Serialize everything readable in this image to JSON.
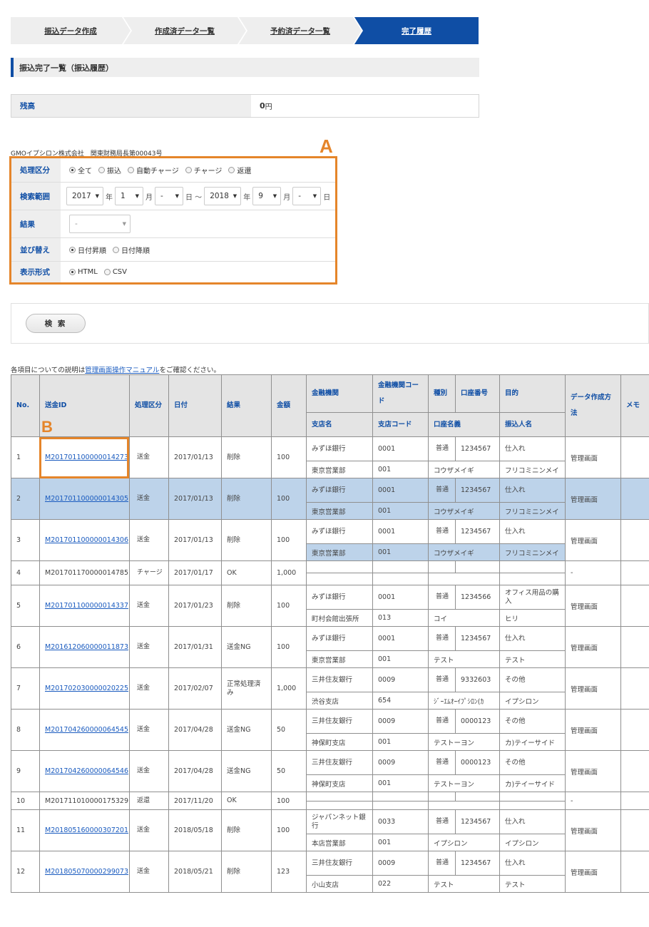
{
  "steps": [
    "振込データ作成",
    "作成済データ一覧",
    "予約済データ一覧",
    "完了履歴"
  ],
  "section_title": "振込完了一覧（振込履歴）",
  "balance": {
    "label": "残高",
    "amount": "0",
    "unit": "円"
  },
  "company": "GMOイプシロン株式会社　関東財務局長第00043号",
  "callouts": {
    "a": "A",
    "b": "B"
  },
  "form": {
    "type_label": "処理区分",
    "type_options": [
      "全て",
      "振込",
      "自動チャージ",
      "チャージ",
      "返還"
    ],
    "range_label": "検索範囲",
    "from_year": "2017",
    "from_month": "1",
    "from_day": "-",
    "to_year": "2018",
    "to_month": "9",
    "to_day": "-",
    "year_unit": "年",
    "month_unit": "月",
    "day_unit": "日",
    "tilde": "日 ～",
    "result_label": "結果",
    "result_value": "-",
    "sort_label": "並び替え",
    "sort_options": [
      "日付昇順",
      "日付降順"
    ],
    "format_label": "表示形式",
    "format_options": [
      "HTML",
      "CSV"
    ]
  },
  "search_button": "検 索",
  "note": {
    "before": "各項目についての説明は",
    "link": "管理画面操作マニュアル",
    "after": "をご確認ください。"
  },
  "headers": {
    "no": "No.",
    "id": "送金ID",
    "kind": "処理区分",
    "date": "日付",
    "result": "結果",
    "amount": "金額",
    "bank": "金融機関",
    "bank_code": "金融機関コード",
    "acc_type": "種別",
    "acc_no": "口座番号",
    "purpose": "目的",
    "branch": "支店名",
    "branch_code": "支店コード",
    "acc_name": "口座名義",
    "payer": "振込人名",
    "method": "データ作成方法",
    "memo": "メモ"
  },
  "rows": [
    {
      "no": "1",
      "id": "M201701100000014273",
      "link": true,
      "kind": "送金",
      "date": "2017/01/13",
      "result": "削除",
      "amount": "100",
      "bank": "みずほ銀行",
      "bank_code": "0001",
      "acc_type": "普通",
      "acc_no": "1234567",
      "purpose": "仕入れ",
      "branch": "東京営業部",
      "branch_code": "001",
      "acc_name": "コウザメイギ",
      "payer": "フリコミニンメイ",
      "method": "管理画面"
    },
    {
      "no": "2",
      "id": "M201701100000014305",
      "link": true,
      "kind": "送金",
      "date": "2017/01/13",
      "result": "削除",
      "amount": "100",
      "bank": "みずほ銀行",
      "bank_code": "0001",
      "acc_type": "普通",
      "acc_no": "1234567",
      "purpose": "仕入れ",
      "branch": "東京営業部",
      "branch_code": "001",
      "acc_name": "コウザメイギ",
      "payer": "フリコミニンメイ",
      "method": "管理画面"
    },
    {
      "no": "3",
      "id": "M201701100000014306",
      "link": true,
      "kind": "送金",
      "date": "2017/01/13",
      "result": "削除",
      "amount": "100",
      "bank": "みずほ銀行",
      "bank_code": "0001",
      "acc_type": "普通",
      "acc_no": "1234567",
      "purpose": "仕入れ",
      "branch": "東京営業部",
      "branch_code": "001",
      "acc_name": "コウザメイギ",
      "payer": "フリコミニンメイ",
      "method": "管理画面"
    },
    {
      "no": "4",
      "id": "M201701170000014785",
      "link": false,
      "kind": "チャージ",
      "date": "2017/01/17",
      "result": "OK",
      "amount": "1,000",
      "bank": "",
      "bank_code": "",
      "acc_type": "",
      "acc_no": "",
      "purpose": "",
      "branch": "",
      "branch_code": "",
      "acc_name": "",
      "payer": "",
      "method": "-"
    },
    {
      "no": "5",
      "id": "M201701100000014337",
      "link": true,
      "kind": "送金",
      "date": "2017/01/23",
      "result": "削除",
      "amount": "100",
      "bank": "みずほ銀行",
      "bank_code": "0001",
      "acc_type": "普通",
      "acc_no": "1234566",
      "purpose": "オフィス用品の購入",
      "branch": "町村会館出張所",
      "branch_code": "013",
      "acc_name": "コイ",
      "payer": "ヒリ",
      "method": "管理画面"
    },
    {
      "no": "6",
      "id": "M201612060000011873",
      "link": true,
      "kind": "送金",
      "date": "2017/01/31",
      "result": "送金NG",
      "amount": "100",
      "bank": "みずほ銀行",
      "bank_code": "0001",
      "acc_type": "普通",
      "acc_no": "1234567",
      "purpose": "仕入れ",
      "branch": "東京営業部",
      "branch_code": "001",
      "acc_name": "テスト",
      "payer": "テスト",
      "method": "管理画面"
    },
    {
      "no": "7",
      "id": "M201702030000020225",
      "link": true,
      "kind": "送金",
      "date": "2017/02/07",
      "result": "正常処理済み",
      "amount": "1,000",
      "bank": "三井住友銀行",
      "bank_code": "0009",
      "acc_type": "普通",
      "acc_no": "9332603",
      "purpose": "その他",
      "branch": "渋谷支店",
      "branch_code": "654",
      "acc_name": "ｼﾞｰｴﾑｵｰｲﾌﾟｼﾛﾝ(ｶ",
      "payer": "イプシロン",
      "method": "管理画面"
    },
    {
      "no": "8",
      "id": "M201704260000064545",
      "link": true,
      "kind": "送金",
      "date": "2017/04/28",
      "result": "送金NG",
      "amount": "50",
      "bank": "三井住友銀行",
      "bank_code": "0009",
      "acc_type": "普通",
      "acc_no": "0000123",
      "purpose": "その他",
      "branch": "神保町支店",
      "branch_code": "001",
      "acc_name": "テストーヨン",
      "payer": "カ)テイーサイド",
      "method": "管理画面"
    },
    {
      "no": "9",
      "id": "M201704260000064546",
      "link": true,
      "kind": "送金",
      "date": "2017/04/28",
      "result": "送金NG",
      "amount": "50",
      "bank": "三井住友銀行",
      "bank_code": "0009",
      "acc_type": "普通",
      "acc_no": "0000123",
      "purpose": "その他",
      "branch": "神保町支店",
      "branch_code": "001",
      "acc_name": "テストーヨン",
      "payer": "カ)テイーサイド",
      "method": "管理画面"
    },
    {
      "no": "10",
      "id": "M201711010000175329",
      "link": false,
      "kind": "返還",
      "date": "2017/11/20",
      "result": "OK",
      "amount": "100",
      "bank": "",
      "bank_code": "",
      "acc_type": "",
      "acc_no": "",
      "purpose": "",
      "branch": "",
      "branch_code": "",
      "acc_name": "",
      "payer": "",
      "method": "-"
    },
    {
      "no": "11",
      "id": "M201805160000307201",
      "link": true,
      "kind": "送金",
      "date": "2018/05/18",
      "result": "削除",
      "amount": "100",
      "bank": "ジャパンネット銀行",
      "bank_code": "0033",
      "acc_type": "普通",
      "acc_no": "1234567",
      "purpose": "仕入れ",
      "branch": "本店営業部",
      "branch_code": "001",
      "acc_name": "イプシロン",
      "payer": "イプシロン",
      "method": "管理画面"
    },
    {
      "no": "12",
      "id": "M201805070000299073",
      "link": true,
      "kind": "送金",
      "date": "2018/05/21",
      "result": "削除",
      "amount": "123",
      "bank": "三井住友銀行",
      "bank_code": "0009",
      "acc_type": "普通",
      "acc_no": "1234567",
      "purpose": "仕入れ",
      "branch": "小山支店",
      "branch_code": "022",
      "acc_name": "テスト",
      "payer": "テスト",
      "method": "管理画面"
    }
  ]
}
